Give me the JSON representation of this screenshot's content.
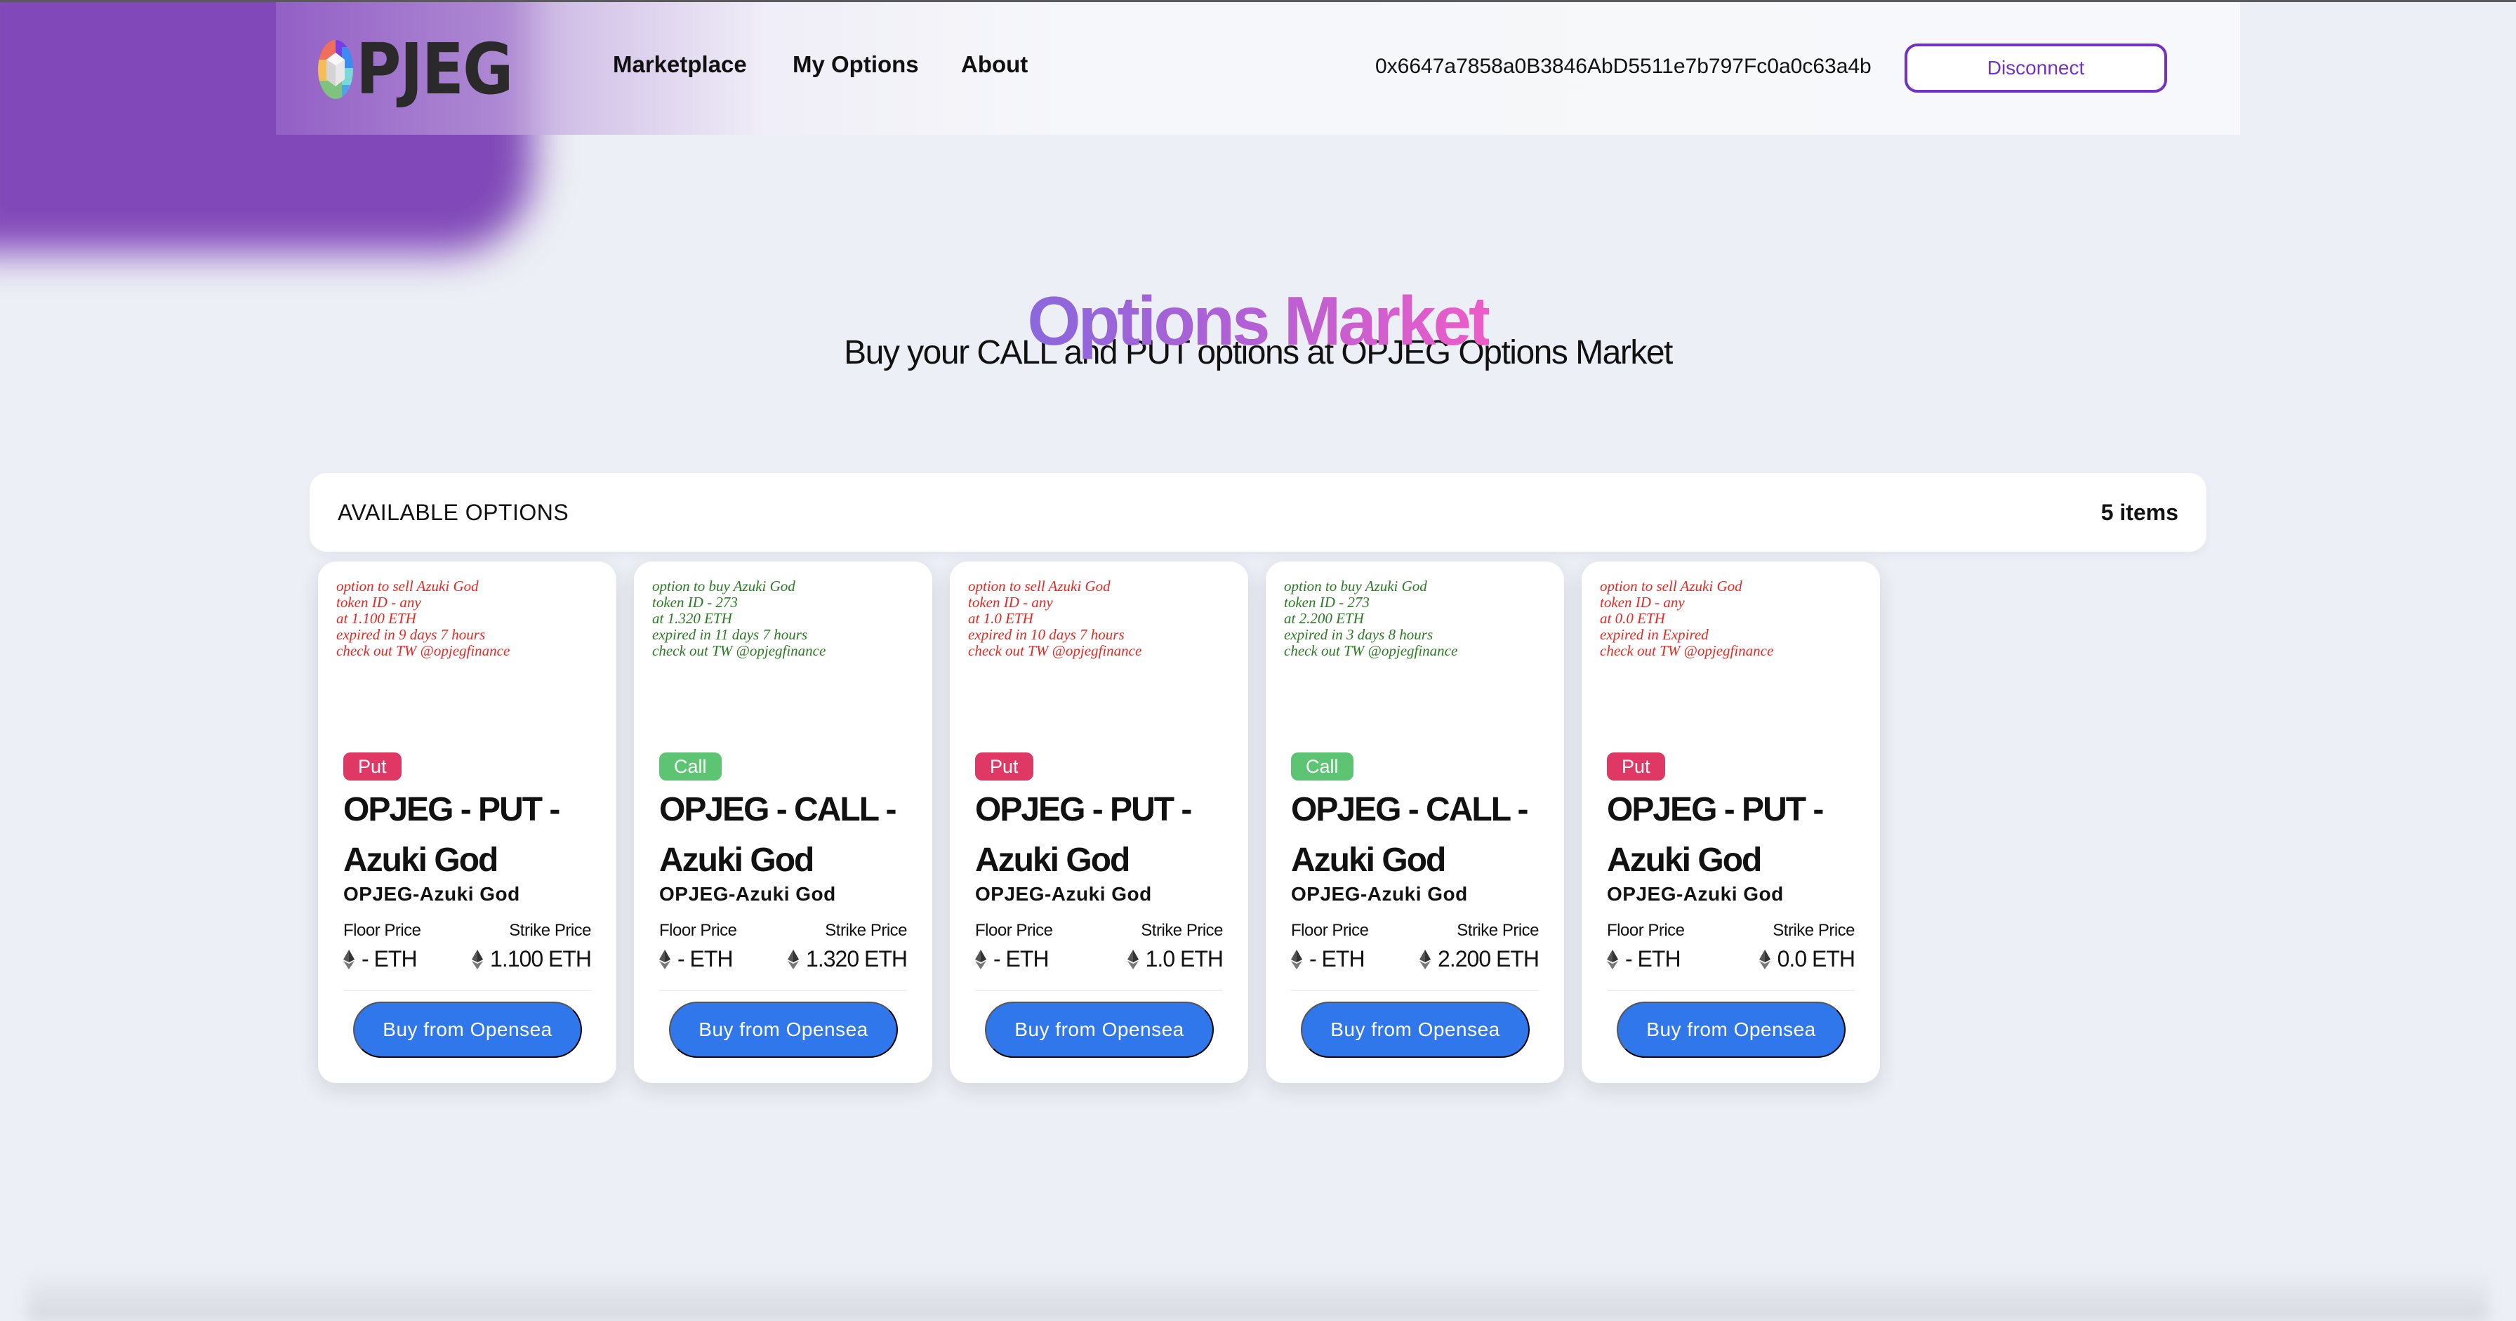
{
  "header": {
    "logo_text": "PJEG",
    "nav": [
      {
        "label": "Marketplace"
      },
      {
        "label": "My Options"
      },
      {
        "label": "About"
      }
    ],
    "wallet_address": "0x6647a7858a0B3846AbD5511e7b797Fc0a0c63a4b",
    "disconnect_label": "Disconnect"
  },
  "hero": {
    "title": "Options Market",
    "subtitle": "Buy your CALL and PUT options at OPJEG Options Market"
  },
  "listing": {
    "title": "AVAILABLE OPTIONS",
    "count": "5 items"
  },
  "colors": {
    "accent_purple": "#7232c4",
    "put_badge": "#e03864",
    "call_badge": "#5cc472",
    "buy_button": "#2f77ea",
    "put_text": "#e02a22",
    "call_text": "#2a7a22"
  },
  "cards": [
    {
      "type": "put",
      "description": "option to sell Azuki God\ntoken ID - any\nat 1.100 ETH\nexpired in 9 days 7 hours\ncheck out TW @opjegfinance",
      "badge": "Put",
      "title": "OPJEG - PUT - Azuki God",
      "collection": "OPJEG-Azuki God",
      "floor_label": "Floor Price",
      "floor_value": "- ETH",
      "strike_label": "Strike Price",
      "strike_value": "1.100 ETH",
      "button": "Buy from Opensea"
    },
    {
      "type": "call",
      "description": "option to buy Azuki God\ntoken ID - 273\nat 1.320 ETH\nexpired in 11 days 7 hours\ncheck out TW @opjegfinance",
      "badge": "Call",
      "title": "OPJEG - CALL - Azuki God",
      "collection": "OPJEG-Azuki God",
      "floor_label": "Floor Price",
      "floor_value": "- ETH",
      "strike_label": "Strike Price",
      "strike_value": "1.320 ETH",
      "button": "Buy from Opensea"
    },
    {
      "type": "put",
      "description": "option to sell Azuki God\ntoken ID - any\nat 1.0 ETH\nexpired in 10 days 7 hours\ncheck out TW @opjegfinance",
      "badge": "Put",
      "title": "OPJEG - PUT - Azuki God",
      "collection": "OPJEG-Azuki God",
      "floor_label": "Floor Price",
      "floor_value": "- ETH",
      "strike_label": "Strike Price",
      "strike_value": "1.0 ETH",
      "button": "Buy from Opensea"
    },
    {
      "type": "call",
      "description": "option to buy Azuki God\ntoken ID - 273\nat 2.200 ETH\nexpired in 3 days 8 hours\ncheck out TW @opjegfinance",
      "badge": "Call",
      "title": "OPJEG - CALL - Azuki God",
      "collection": "OPJEG-Azuki God",
      "floor_label": "Floor Price",
      "floor_value": "- ETH",
      "strike_label": "Strike Price",
      "strike_value": "2.200 ETH",
      "button": "Buy from Opensea"
    },
    {
      "type": "put",
      "description": "option to sell Azuki God\ntoken ID - any\nat 0.0 ETH\nexpired in Expired\ncheck out TW @opjegfinance",
      "badge": "Put",
      "title": "OPJEG - PUT - Azuki God",
      "collection": "OPJEG-Azuki God",
      "floor_label": "Floor Price",
      "floor_value": "- ETH",
      "strike_label": "Strike Price",
      "strike_value": "0.0 ETH",
      "button": "Buy from Opensea"
    }
  ]
}
